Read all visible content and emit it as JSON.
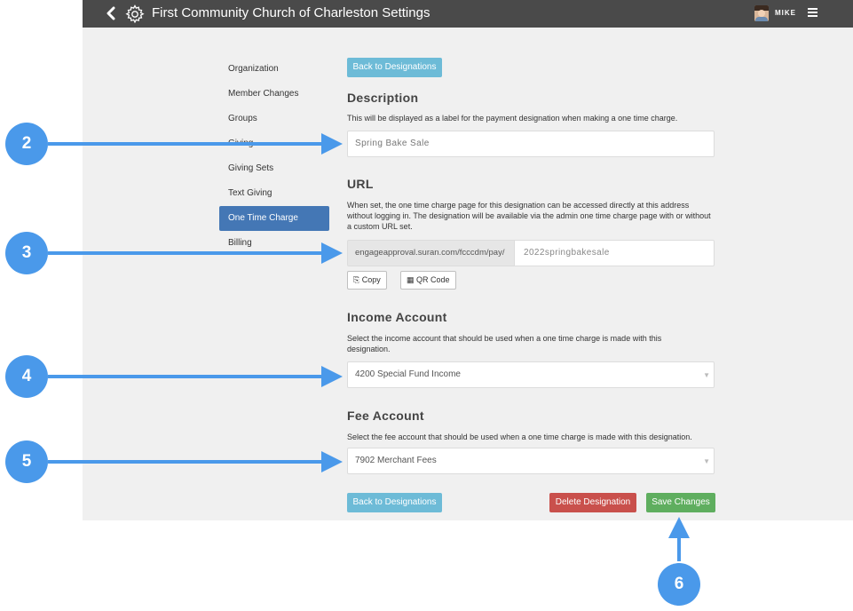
{
  "header": {
    "title": "First Community Church of Charleston  Settings",
    "user_name": "MIKE",
    "icons": [
      "chevron-left-icon",
      "gear-icon",
      "avatar",
      "hamburger-menu-icon"
    ]
  },
  "sidebar": {
    "items": [
      {
        "label": "Organization"
      },
      {
        "label": "Member Changes"
      },
      {
        "label": "Groups"
      },
      {
        "label": "Giving"
      },
      {
        "label": "Giving Sets"
      },
      {
        "label": "Text Giving"
      },
      {
        "label": "One Time Charge"
      },
      {
        "label": "Billing"
      }
    ],
    "active": "One Time Charge"
  },
  "form": {
    "back_label": "Back to Designations",
    "description": {
      "heading": "Description",
      "help": "This will be displayed as a label for the payment designation when making a one time charge.",
      "value": "Spring Bake Sale"
    },
    "url": {
      "heading": "URL",
      "help": "When set, the one time charge page for this designation can be accessed directly at this address without logging in. The designation will be available via the admin one time charge page with or without a custom URL set.",
      "prefix": "engageapproval.suran.com/fcccdm/pay/",
      "value": "2022springbakesale",
      "copy_label": "Copy",
      "qr_label": "QR Code"
    },
    "income": {
      "heading": "Income Account",
      "help": "Select the income account that should be used when a one time charge is made with this designation.",
      "value": "4200 Special Fund Income"
    },
    "fee": {
      "heading": "Fee Account",
      "help": "Select the fee account that should be used when a one time charge is made with this designation.",
      "value": "7902 Merchant Fees"
    },
    "delete_label": "Delete Designation",
    "save_label": "Save Changes"
  },
  "callouts": [
    "2",
    "3",
    "4",
    "5",
    "6"
  ],
  "colors": {
    "topbar": "#4a4a4a",
    "active_nav": "#4477b5",
    "info_button": "#6dbbd7",
    "danger_button": "#c9504c",
    "success_button": "#5fae5f",
    "callout": "#4a99ea"
  }
}
